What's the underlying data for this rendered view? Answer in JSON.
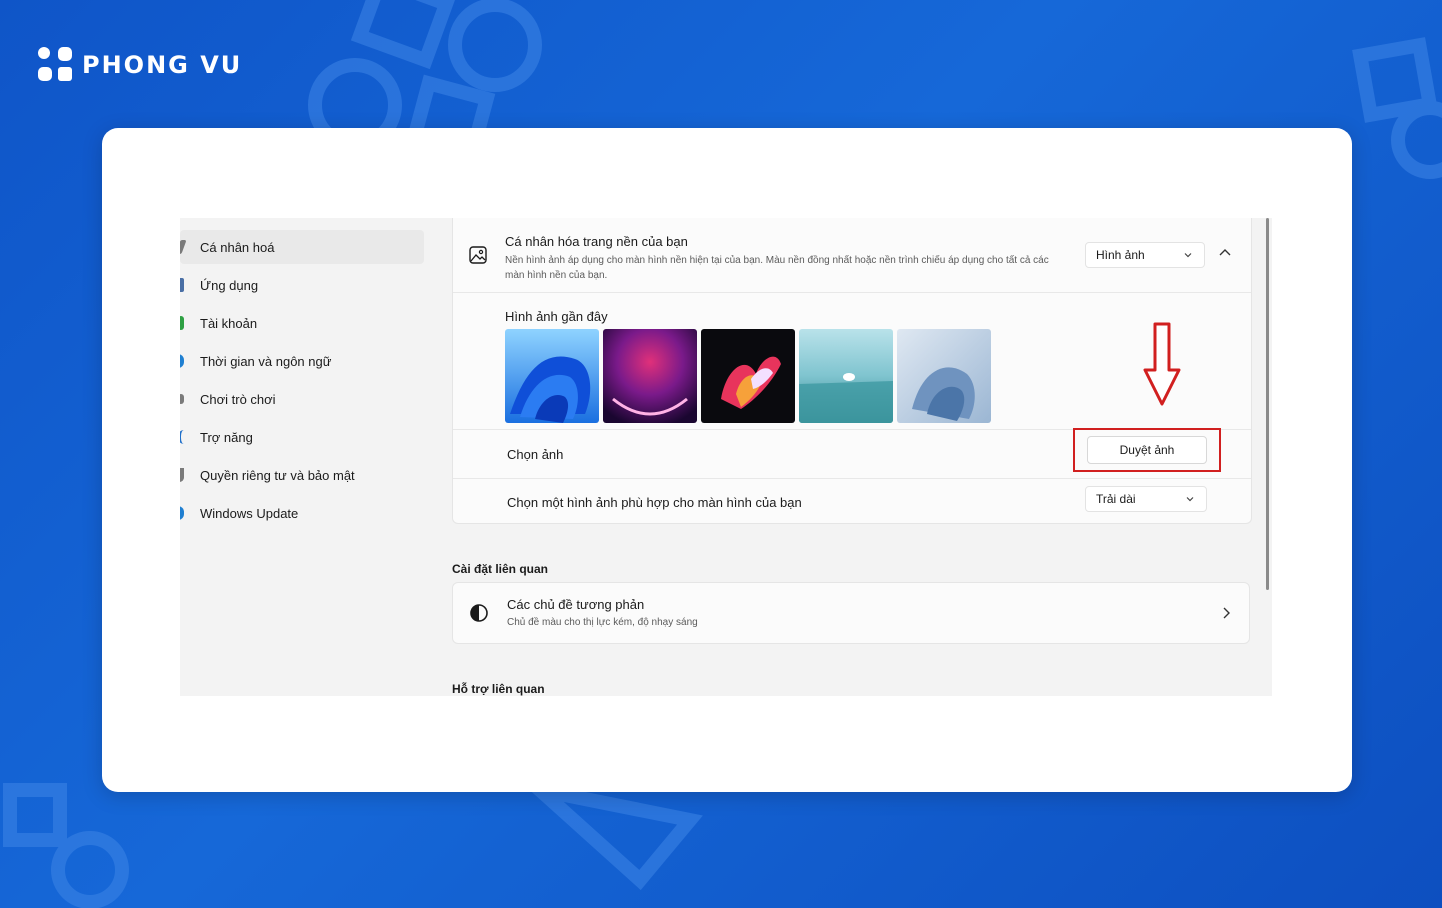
{
  "brand": {
    "name": "PHONG VU",
    "logo_icon": "phongvu-logo-icon"
  },
  "colors": {
    "background": "#1262d2",
    "accent_red": "#d11f1f",
    "card": "#ffffff"
  },
  "nav": {
    "items": [
      {
        "label": "Cá nhân hoá",
        "selected": true,
        "icon": "brush-icon",
        "icon_color": "#7a7a7a"
      },
      {
        "label": "Ứng dụng",
        "icon": "apps-icon",
        "icon_color": "#4a6fa5"
      },
      {
        "label": "Tài khoản",
        "icon": "account-icon",
        "icon_color": "#2ea043"
      },
      {
        "label": "Thời gian và ngôn ngữ",
        "icon": "globe-clock-icon",
        "icon_color": "#1f7fd1"
      },
      {
        "label": "Chơi trò chơi",
        "icon": "gamepad-icon",
        "icon_color": "#7a7a7a"
      },
      {
        "label": "Trợ năng",
        "icon": "accessibility-icon",
        "icon_color": "#1f6fc9"
      },
      {
        "label": "Quyền riêng tư và bảo mật",
        "icon": "shield-icon",
        "icon_color": "#7a7a7a"
      },
      {
        "label": "Windows Update",
        "icon": "update-icon",
        "icon_color": "#1f7fd1"
      }
    ]
  },
  "background_section": {
    "title": "Cá nhân hóa trang nền của bạn",
    "description": "Nền hình ảnh áp dụng cho màn hình nền hiện tại của bạn. Màu nền đồng nhất hoặc nền trình chiếu áp dụng cho tất cả các màn hình nền của bạn.",
    "type_value": "Hình ảnh",
    "recent_title": "Hình ảnh gần đây",
    "choose_label": "Chọn ảnh",
    "browse_label": "Duyệt ảnh",
    "fit_label": "Chọn một hình ảnh phù hợp cho màn hình của bạn",
    "fit_value": "Trải dài"
  },
  "related": {
    "title": "Cài đặt liên quan",
    "contrast_title": "Các chủ đề tương phản",
    "contrast_desc": "Chủ đề màu cho thị lực kém, độ nhạy sáng"
  },
  "support": {
    "title": "Hỗ trợ liên quan"
  }
}
